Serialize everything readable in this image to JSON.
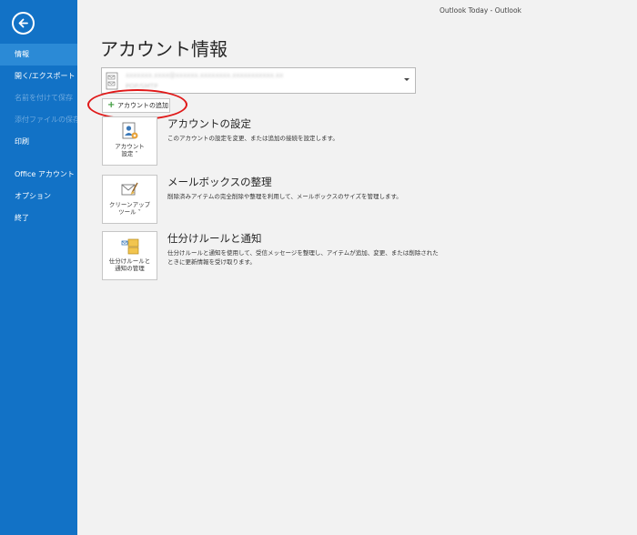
{
  "window": {
    "title": "Outlook Today - Outlook"
  },
  "sidebar": {
    "back_icon": "back-arrow-icon",
    "items": [
      {
        "label": "情報",
        "active": true,
        "enabled": true
      },
      {
        "label": "開く/エクスポート",
        "active": false,
        "enabled": true
      },
      {
        "label": "名前を付けて保存",
        "active": false,
        "enabled": false
      },
      {
        "label": "添付ファイルの保存",
        "active": false,
        "enabled": false
      },
      {
        "label": "印刷",
        "active": false,
        "enabled": true
      },
      {
        "label": "Office アカウント",
        "active": false,
        "enabled": true
      },
      {
        "label": "オプション",
        "active": false,
        "enabled": true
      },
      {
        "label": "終了",
        "active": false,
        "enabled": true
      }
    ]
  },
  "main": {
    "page_title": "アカウント情報",
    "account_selector": {
      "email": "xxxxxxx.xxxx@xxxxxx.xxxxxxxx.xxxxxxxxxxx.xx",
      "type": "POP/SMTP"
    },
    "add_account_label": "アカウントの追加",
    "sections": [
      {
        "id": "account-settings",
        "tile_label_1": "アカウント",
        "tile_label_2": "設定 ˅",
        "title": "アカウントの設定",
        "description": "このアカウントの設定を変更、または追加の接続を設定します。",
        "icon": "account-settings-icon"
      },
      {
        "id": "mailbox-cleanup",
        "tile_label_1": "クリーンアップ",
        "tile_label_2": "ツール ˅",
        "title": "メールボックスの整理",
        "description": "削除済みアイテムの完全削除や整理を利用して、メールボックスのサイズを管理します。",
        "icon": "cleanup-tools-icon"
      },
      {
        "id": "rules-alerts",
        "tile_label_1": "仕分けルールと",
        "tile_label_2": "通知の管理",
        "title": "仕分けルールと通知",
        "description": "仕分けルールと通知を使用して、受信メッセージを整理し、アイテムが追加、変更、または削除されたときに更新情報を受け取ります。",
        "icon": "rules-alerts-icon"
      }
    ]
  },
  "colors": {
    "sidebar": "#1272c6",
    "sidebar_active": "#2b8ad6",
    "highlight_ring": "#e01919"
  }
}
